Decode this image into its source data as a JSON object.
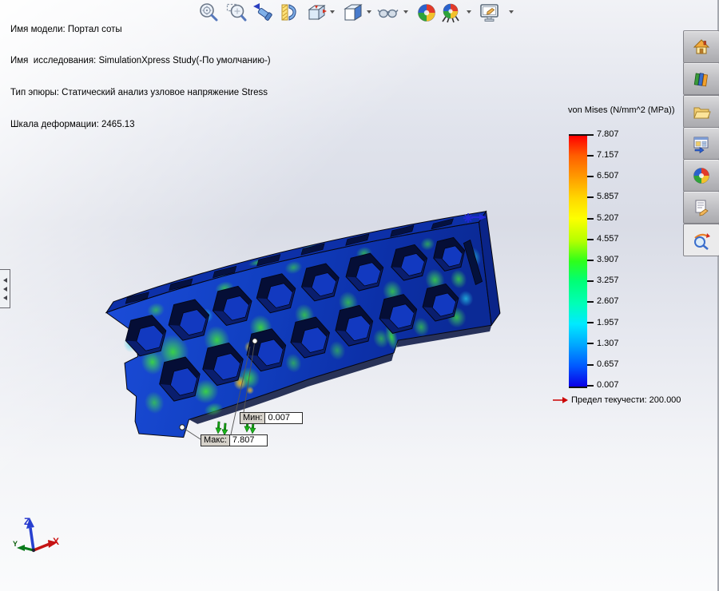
{
  "annotations": {
    "model_name": "Имя модели: Портал соты",
    "study_name": "Имя  исследования: SimulationXpress Study(-По умолчанию-)",
    "plot_type": "Тип эпюры: Статический анализ узловое напряжение Stress",
    "deformation_scale": "Шкала деформации: 2465.13"
  },
  "toolbar": {
    "icons": [
      "zoom-to-fit",
      "zoom-to-area",
      "previous-view",
      "section-view",
      "view-orientation",
      "display-style",
      "hide-show-items",
      "edit-appearance",
      "apply-scene",
      "view-settings"
    ]
  },
  "legend": {
    "title": "von Mises (N/mm^2 (MPa))",
    "values": [
      "7.807",
      "7.157",
      "6.507",
      "5.857",
      "5.207",
      "4.557",
      "3.907",
      "3.257",
      "2.607",
      "1.957",
      "1.307",
      "0.657",
      "0.007"
    ],
    "yield_label": "Предел текучести: 200.000",
    "gradient_stops": [
      "#ff0000",
      "#ff9f00",
      "#fdff00",
      "#2eff1a",
      "#00ffb7",
      "#00eaff",
      "#0057ff",
      "#0a00e6"
    ]
  },
  "callouts": {
    "min_label": "Мин:",
    "min_value": "0.007",
    "max_label": "Макс:",
    "max_value": "7.807"
  },
  "triad": {
    "x_label": "X",
    "y_label": "Y",
    "z_label": "Z"
  },
  "task_pane": {
    "icons": [
      "home",
      "design-library",
      "file-explorer",
      "view-palette",
      "appearances-scenes",
      "custom-properties",
      "analysis-advisor"
    ]
  },
  "colors": {
    "yield_arrow": "#cc0000",
    "model_base_blue": "#1140c2",
    "stress_green": "#3cdc3c",
    "fixture_green": "#18a818",
    "load_blue": "#2228d8",
    "background_band": "#d9dce6"
  }
}
